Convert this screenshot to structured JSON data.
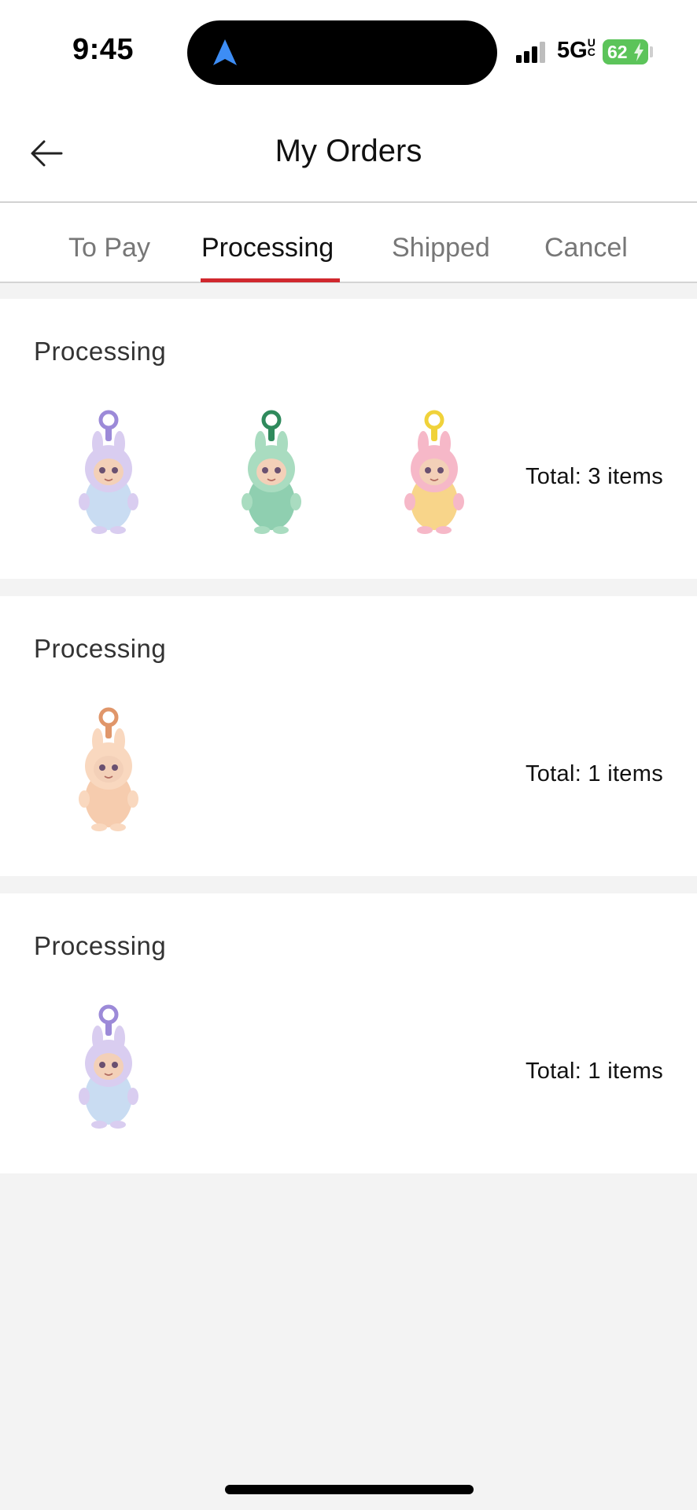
{
  "status_bar": {
    "time": "9:45",
    "network": "5G",
    "network_sup": "UC",
    "battery": "62",
    "icons": [
      "navigation-arrow-icon",
      "signal-icon",
      "battery-icon"
    ]
  },
  "header": {
    "title": "My Orders",
    "back_icon": "back-arrow-icon"
  },
  "tabs": [
    {
      "label": "To Pay",
      "active": false
    },
    {
      "label": "Processing",
      "active": true
    },
    {
      "label": "Shipped",
      "active": false
    },
    {
      "label": "Cancel",
      "active": false
    }
  ],
  "colors": {
    "accent": "#d0282e",
    "page_bg": "#f3f3f3",
    "battery": "#5cc45a"
  },
  "orders": [
    {
      "status": "Processing",
      "total": "Total: 3 items",
      "items": [
        {
          "name": "plush-keychain-lavender",
          "ring": "#9c8ad8",
          "body": "#d9cdf0",
          "belly": "#c9dcf2"
        },
        {
          "name": "plush-keychain-mint",
          "ring": "#2f8a5c",
          "body": "#a9dcc0",
          "belly": "#8fcfb0"
        },
        {
          "name": "plush-keychain-rainbow",
          "ring": "#f0d23a",
          "body": "#f6b8c8",
          "belly": "#f8d58a"
        }
      ]
    },
    {
      "status": "Processing",
      "total": "Total: 1 items",
      "items": [
        {
          "name": "plush-keychain-peach",
          "ring": "#e0966a",
          "body": "#f9d8bf",
          "belly": "#f6ccae"
        }
      ]
    },
    {
      "status": "Processing",
      "total": "Total: 1 items",
      "items": [
        {
          "name": "plush-keychain-lavender",
          "ring": "#9c8ad8",
          "body": "#d9cdf0",
          "belly": "#c9dcf2"
        }
      ]
    }
  ]
}
